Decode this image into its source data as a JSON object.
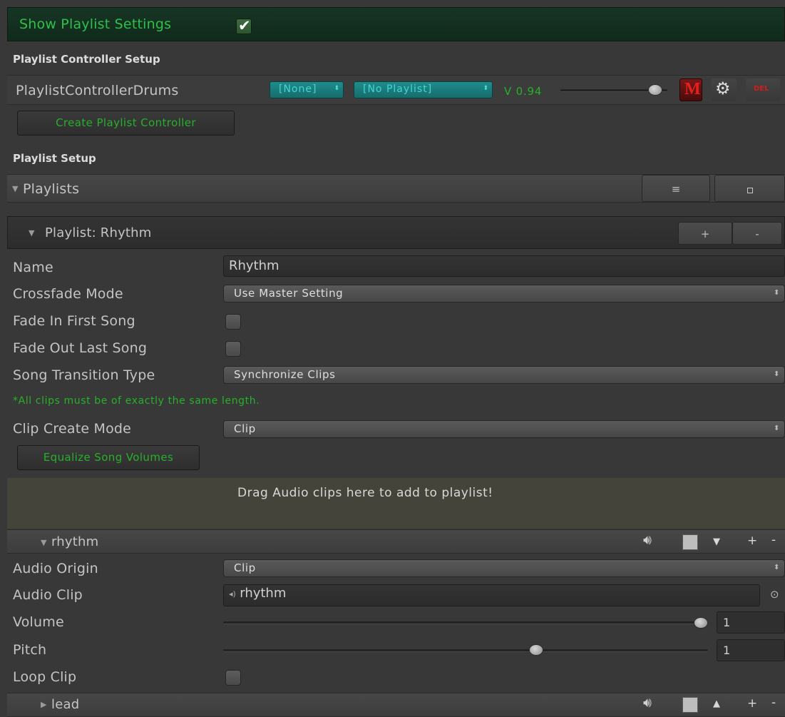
{
  "show_settings": {
    "label": "Show Playlist Settings",
    "checked": true
  },
  "controller_setup": {
    "heading": "Playlist Controller Setup",
    "controller_name": "PlaylistControllerDrums",
    "group_dropdown": "[None]",
    "playlist_dropdown": "[No Playlist]",
    "volume_label": "V 0.94",
    "volume_value": 0.94,
    "mute_label": "M",
    "delete_label": "DEL",
    "create_button": "Create Playlist Controller"
  },
  "playlist_setup": {
    "heading": "Playlist Setup",
    "playlists_label": "Playlists",
    "list_icon": "≡",
    "square_icon": "▫"
  },
  "playlist": {
    "header": "Playlist: Rhythm",
    "add": "+",
    "remove": "-",
    "fields": {
      "name_label": "Name",
      "name_value": "Rhythm",
      "crossfade_label": "Crossfade Mode",
      "crossfade_value": "Use Master Setting",
      "fade_in_label": "Fade In First Song",
      "fade_out_label": "Fade Out Last Song",
      "transition_label": "Song Transition Type",
      "transition_value": "Synchronize Clips",
      "note": "*All clips must be of exactly the same length.",
      "clip_mode_label": "Clip Create Mode",
      "clip_mode_value": "Clip",
      "equalize_button": "Equalize Song Volumes"
    },
    "drop_zone": "Drag Audio clips here to add to playlist!"
  },
  "songs": [
    {
      "name": "rhythm",
      "expanded": true,
      "audio_origin_label": "Audio Origin",
      "audio_origin_value": "Clip",
      "audio_clip_label": "Audio Clip",
      "audio_clip_value": "rhythm",
      "volume_label": "Volume",
      "volume_value": "1",
      "volume_level": 1.0,
      "pitch_label": "Pitch",
      "pitch_value": "1",
      "pitch_level": 0.65,
      "loop_label": "Loop Clip"
    },
    {
      "name": "lead",
      "expanded": false
    }
  ],
  "icons": {
    "speaker": "speaker-icon",
    "stop": "stop-square-icon",
    "down": "arrow-down-icon",
    "up": "arrow-up-icon",
    "plus": "+",
    "minus": "-",
    "gear": "gear-icon",
    "object_picker": "object-picker-icon",
    "disclosure_open": "▼",
    "disclosure_closed": "▶"
  },
  "colors": {
    "accent_green": "#27b02a",
    "teal_dropdown": "#1b7b7b",
    "panel_bg": "#383838",
    "drop_zone_bg": "#44443a",
    "mute_red": "#8b1414"
  }
}
